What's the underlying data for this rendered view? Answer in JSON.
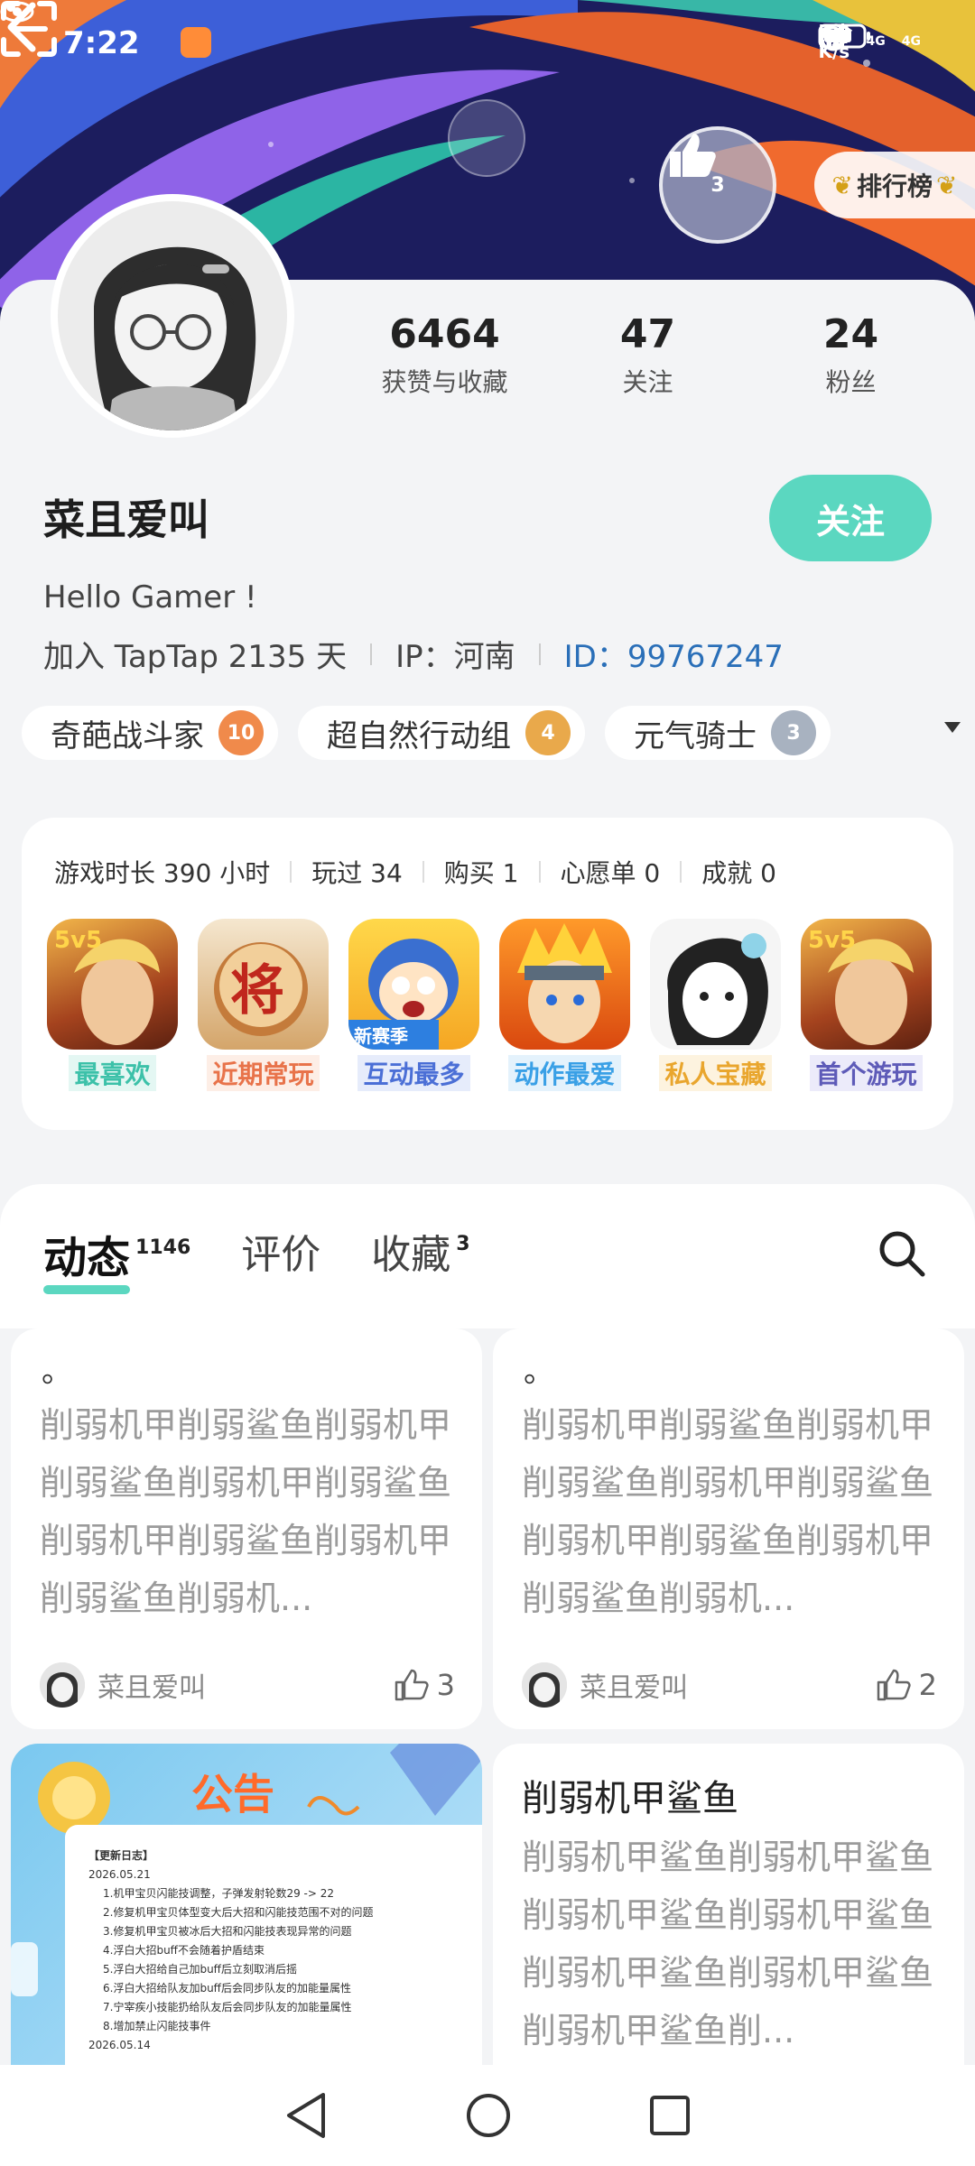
{
  "status_bar": {
    "time": "7:22",
    "net_speed_value": "5.9",
    "net_speed_unit": "K/s",
    "sim1": "4G",
    "sim2": "4G"
  },
  "header": {
    "rank_label": "排行榜",
    "badge_number": "3"
  },
  "profile": {
    "stats": [
      {
        "value": "6464",
        "label": "获赞与收藏"
      },
      {
        "value": "47",
        "label": "关注"
      },
      {
        "value": "24",
        "label": "粉丝"
      }
    ],
    "username": "菜且爱叫",
    "follow_label": "关注",
    "bio": "Hello Gamer !",
    "joined": "加入 TapTap 2135 天",
    "ip": "IP：河南",
    "id_label": "ID：",
    "id_value": "99767247",
    "tags": [
      {
        "name": "奇葩战斗家",
        "level": "10",
        "color": "#f08a4b"
      },
      {
        "name": "超自然行动组",
        "level": "4",
        "color": "#e9a94b"
      },
      {
        "name": "元气骑士",
        "level": "3",
        "color": "#a8b2c0"
      }
    ]
  },
  "games": {
    "playtime": "游戏时长 390 小时",
    "played": "玩过 34",
    "bought": "购买 1",
    "wishlist": "心愿单 0",
    "achievements": "成就 0",
    "items": [
      {
        "label": "最喜欢",
        "color": "#3cc1a9",
        "bg": "#e4f7f3",
        "icon_text": "5v5"
      },
      {
        "label": "近期常玩",
        "color": "#e8734a",
        "bg": "#fdeee6",
        "icon_text": "将"
      },
      {
        "label": "互动最多",
        "color": "#4b6fd6",
        "bg": "#e6ecfb",
        "icon_text": "新赛季"
      },
      {
        "label": "动作最爱",
        "color": "#3aa0e6",
        "bg": "#e4f2fc",
        "icon_text": ""
      },
      {
        "label": "私人宝藏",
        "color": "#e9a62e",
        "bg": "#fdf3df",
        "icon_text": ""
      },
      {
        "label": "首个游玩",
        "color": "#5e5bb8",
        "bg": "#ecebfa",
        "icon_text": "5v5"
      }
    ]
  },
  "content": {
    "tabs": [
      {
        "label": "动态",
        "count": "1146"
      },
      {
        "label": "评价",
        "count": ""
      },
      {
        "label": "收藏",
        "count": "3"
      }
    ],
    "posts": [
      {
        "dot": "。",
        "text": "削弱机甲削弱鲨鱼削弱机甲削弱鲨鱼削弱机甲削弱鲨鱼削弱机甲削弱鲨鱼削弱机甲削弱鲨鱼削弱机...",
        "author": "菜且爱叫",
        "likes": "3"
      },
      {
        "dot": "。",
        "text": "削弱机甲削弱鲨鱼削弱机甲削弱鲨鱼削弱机甲削弱鲨鱼削弱机甲削弱鲨鱼削弱机甲削弱鲨鱼削弱机...",
        "author": "菜且爱叫",
        "likes": "2"
      },
      {
        "title": "削弱机甲鲨鱼",
        "text": "削弱机甲鲨鱼削弱机甲鲨鱼削弱机甲鲨鱼削弱机甲鲨鱼削弱机甲鲨鱼削弱机甲鲨鱼削弱机甲鲨鱼削..."
      }
    ],
    "notice": {
      "title": "公告",
      "heading": "【更新日志】",
      "date1": "2026.05.21",
      "lines": [
        "1.机甲宝贝闪能技调整，子弹发射轮数29 -> 22",
        "2.修复机甲宝贝体型变大后大招和闪能技范围不对的问题",
        "3.修复机甲宝贝被冰后大招和闪能技表现异常的问题",
        "4.浮白大招buff不会随着护盾结束",
        "5.浮白大招给自己加buff后立刻取消后摇",
        "6.浮白大招给队友加buff后会同步队友的加能量属性",
        "7.宁宰疾小技能扔给队友后会同步队友的加能量属性",
        "8.增加禁止闪能技事件"
      ],
      "date2": "2026.05.14"
    }
  }
}
